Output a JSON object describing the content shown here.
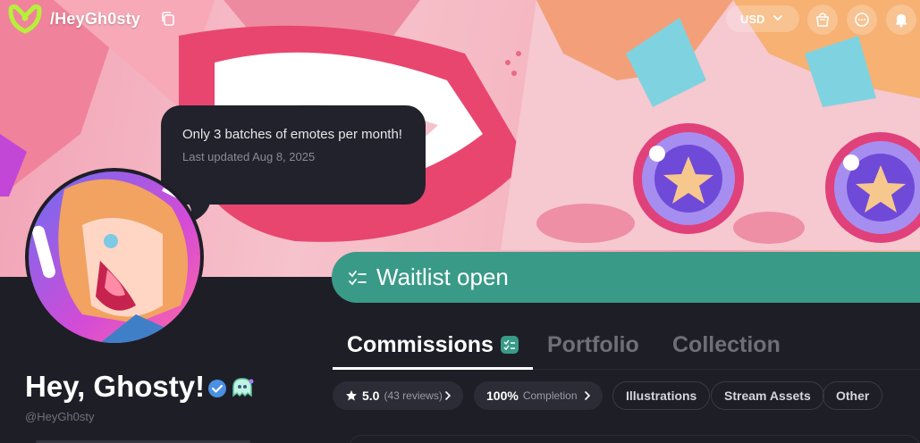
{
  "topbar": {
    "handle": "/HeyGh0sty",
    "currency": "USD"
  },
  "tooltip": {
    "message": "Only 3 batches of emotes per month!",
    "updated": "Last updated Aug 8, 2025"
  },
  "profile": {
    "name": "Hey, Ghosty!",
    "handle": "@HeyGh0sty"
  },
  "waitlist": {
    "label": "Waitlist open"
  },
  "tabs": [
    {
      "label": "Commissions",
      "active": true
    },
    {
      "label": "Portfolio",
      "active": false
    },
    {
      "label": "Collection",
      "active": false
    }
  ],
  "chips": {
    "rating_value": "5.0",
    "rating_reviews": "(43 reviews)",
    "completion_value": "100%",
    "completion_label": "Completion",
    "categories": [
      "Illustrations",
      "Stream Assets",
      "Other"
    ]
  },
  "colors": {
    "accent": "#3a9a88",
    "background": "#1e1e27",
    "brand": "#b6f03a"
  },
  "icons": [
    "copy-icon",
    "chevron-down-icon",
    "shopping-bag-icon",
    "chat-icon",
    "bell-icon",
    "verified-icon",
    "ghost-badge-icon",
    "checklist-icon",
    "star-icon",
    "chevron-right-icon"
  ]
}
